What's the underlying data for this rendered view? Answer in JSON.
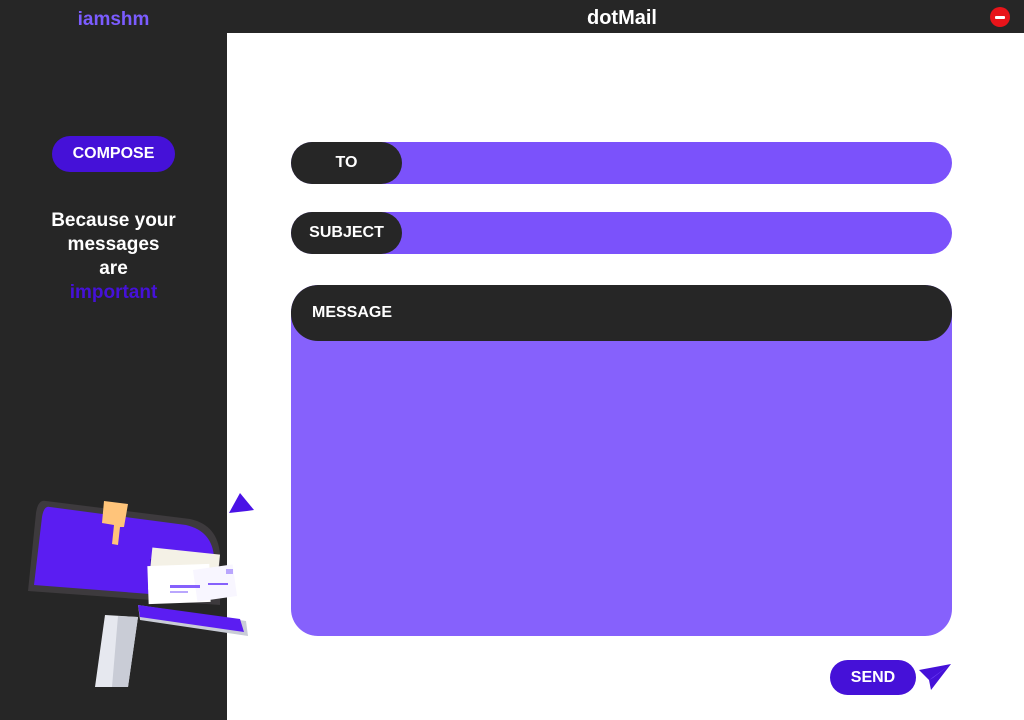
{
  "titlebar": {
    "brand": "iamshm",
    "title": "dotMail",
    "close_icon": "minus-circle-icon"
  },
  "sidebar": {
    "compose_label": "COMPOSE",
    "tagline": {
      "line1": "Because your",
      "line2": "messages",
      "line3": "are",
      "highlight": "important"
    },
    "illustration": "mailbox-illustration"
  },
  "form": {
    "to": {
      "label": "TO",
      "value": ""
    },
    "subject": {
      "label": "SUBJECT",
      "value": ""
    },
    "message": {
      "label": "MESSAGE",
      "value": ""
    },
    "send_label": "SEND",
    "send_icon": "paper-plane-icon"
  },
  "colors": {
    "background_dark": "#262626",
    "accent_deep": "#4511d8",
    "accent_field": "#7b52fb",
    "accent_message": "#8661fc",
    "brand_text": "#7b5cff",
    "close_red": "#e8141a",
    "main_bg": "#ffffff"
  }
}
